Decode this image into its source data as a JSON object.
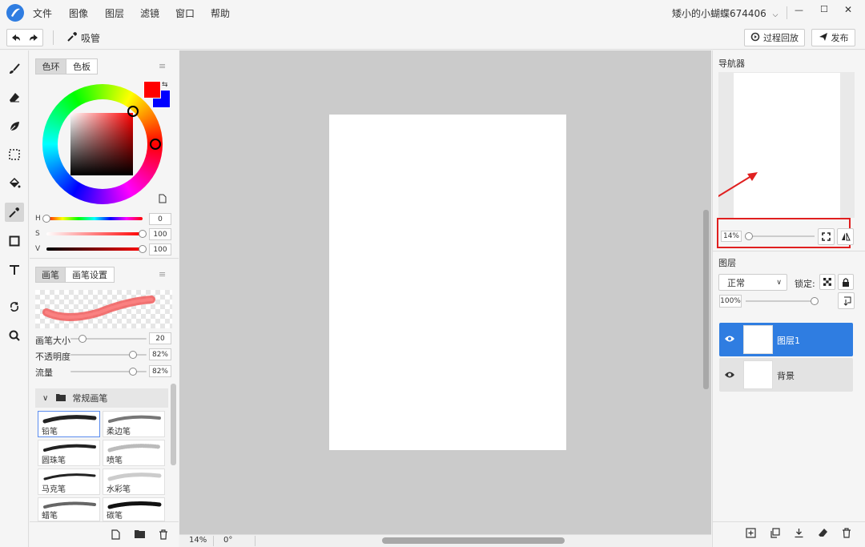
{
  "app": {
    "user": "矮小的小蝴蝶674406"
  },
  "menu": [
    "文件",
    "图像",
    "图层",
    "滤镜",
    "窗口",
    "帮助"
  ],
  "window_controls": {
    "minimize": "—",
    "maximize": "☐",
    "close": "✕"
  },
  "toolbar": {
    "tool_name": "吸管",
    "replay": "过程回放",
    "publish": "发布"
  },
  "color_panel": {
    "tabs": [
      "色环",
      "色板"
    ],
    "primary_color": "#ff0000",
    "secondary_color": "#0000ff",
    "h_label": "H",
    "s_label": "S",
    "v_label": "V",
    "h": "0",
    "s": "100",
    "v": "100",
    "h_fraction": 0,
    "s_fraction": 1,
    "v_fraction": 1
  },
  "brush_panel": {
    "tabs": [
      "画笔",
      "画笔设置"
    ],
    "size_label": "画笔大小",
    "size": "20",
    "size_fraction": 0.16,
    "opacity_label": "不透明度",
    "opacity": "82%",
    "opacity_fraction": 0.82,
    "flow_label": "流量",
    "flow": "82%",
    "flow_fraction": 0.82,
    "group": "常规画笔",
    "brushes": [
      "铅笔",
      "柔边笔",
      "圆珠笔",
      "喷笔",
      "马克笔",
      "水彩笔",
      "蜡笔",
      "碳笔"
    ]
  },
  "status": {
    "zoom": "14%",
    "rotation": "0°"
  },
  "navigator": {
    "title": "导航器",
    "zoom": "14%",
    "zoom_fraction": 0.05
  },
  "layers": {
    "title": "图层",
    "blend": "正常",
    "lock_label": "锁定:",
    "opacity": "100%",
    "opacity_fraction": 1,
    "items": [
      {
        "name": "图层1",
        "selected": true
      },
      {
        "name": "背景",
        "selected": false
      }
    ]
  },
  "colors": {
    "accent": "#2f7de1",
    "highlight": "#e02020"
  }
}
